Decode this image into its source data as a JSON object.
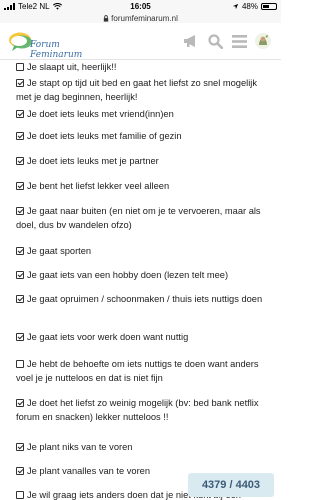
{
  "status": {
    "carrier": "Tele2 NL",
    "time": "16:05",
    "battery": "48%",
    "battery_level": 0.48
  },
  "url": "forumfeminarum.nl",
  "header": {
    "logo_text": "Forum Feminarum",
    "icons": [
      "megaphone-icon",
      "search-icon",
      "menu-icon",
      "avatar-icon"
    ]
  },
  "items": [
    {
      "checked": false,
      "text": "Je slaapt uit, heerlijk!!"
    },
    {
      "checked": true,
      "text": "Je stapt op tijd uit bed en gaat het liefst zo snel mogelijk met je dag beginnen, heerlijk!"
    },
    {
      "checked": true,
      "text": "Je doet iets leuks met vriend(inn)en"
    },
    {
      "checked": true,
      "text": "Je doet iets leuks met familie of gezin"
    },
    {
      "checked": true,
      "text": "Je doet iets leuks met je partner"
    },
    {
      "checked": true,
      "text": "Je bent het liefst lekker veel alleen"
    },
    {
      "checked": true,
      "text": "Je gaat naar buiten (en niet om je te vervoeren, maar als doel, dus bv wandelen ofzo)"
    },
    {
      "checked": true,
      "text": "Je gaat sporten"
    },
    {
      "checked": true,
      "text": "Je gaat iets van een hobby doen (lezen telt mee)"
    },
    {
      "checked": true,
      "text": "Je gaat opruimen / schoonmaken / thuis iets nuttigs doen"
    },
    {
      "checked": true,
      "text": "Je gaat iets voor werk doen want nuttig"
    },
    {
      "checked": false,
      "text": "Je hebt de behoefte om iets nuttigs te doen want anders voel je je nutteloos en dat is niet fijn"
    },
    {
      "checked": true,
      "text": "Je doet het liefst zo weinig mogelijk (bv: bed bank netflix forum en snacken) lekker nutteloos !!"
    },
    {
      "checked": true,
      "text": "Je plant niks van te voren"
    },
    {
      "checked": true,
      "text": "Je plant vanalles van te voren"
    },
    {
      "checked": false,
      "text": "Je wil graag iets anders doen dat je niet kunt bij een mogelijkheid in deze categorieën kan pa"
    }
  ],
  "counter": "4379 / 4403"
}
